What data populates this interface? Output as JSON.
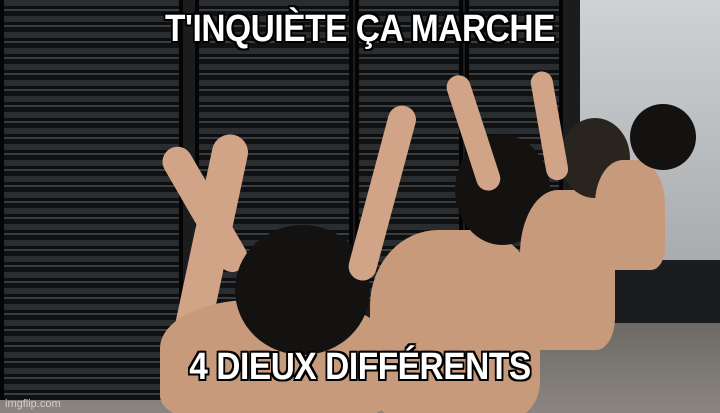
{
  "meme": {
    "top_text": "T'INQUIÈTE ÇA MARCHE",
    "bottom_text": "4 DIEUX DIFFÉRENTS",
    "watermark": "imgflip.com"
  }
}
